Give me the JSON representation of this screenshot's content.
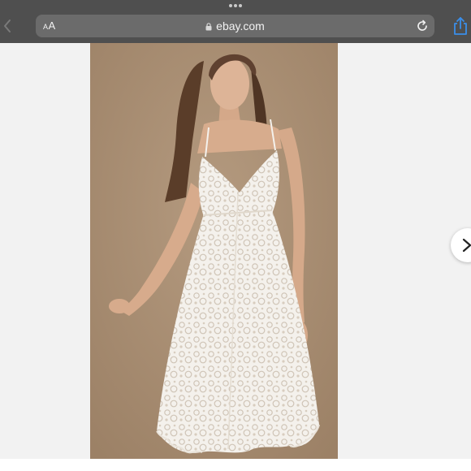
{
  "browser": {
    "text_size_label_small": "A",
    "text_size_label_large": "A",
    "url": "ebay.com"
  },
  "icons": {
    "more": "more-dots-icon",
    "back": "back-arrow-icon",
    "lock": "lock-icon",
    "reload": "reload-icon",
    "share": "share-icon",
    "next": "chevron-right-icon"
  },
  "colors": {
    "chrome": "#4f4f4f",
    "address_bar": "#6b6b6b",
    "share_blue": "#3a8eea",
    "page_background": "#f2f2f2",
    "photo_background": "#a68b70"
  }
}
